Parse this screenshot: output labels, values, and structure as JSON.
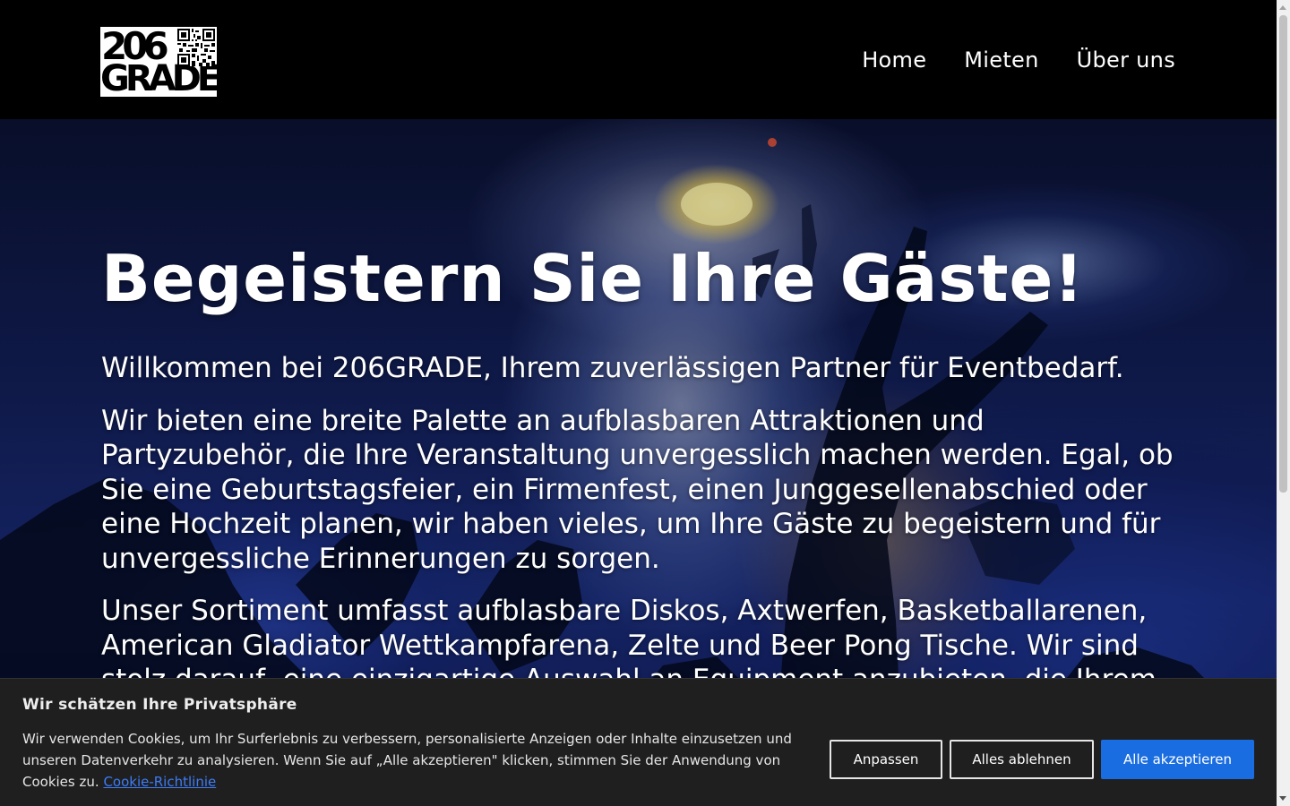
{
  "logo": {
    "line1": "206",
    "line2": "GRADE",
    "qr_icon": "qr-code-icon"
  },
  "nav": {
    "items": [
      "Home",
      "Mieten",
      "Über uns"
    ]
  },
  "hero": {
    "title": "Begeistern Sie Ihre Gäste!",
    "paragraph1": "Willkommen bei 206GRADE, Ihrem zuverlässigen Partner für Eventbedarf.",
    "paragraph2": "Wir bieten eine breite Palette an aufblasbaren Attraktionen und Partyzubehör, die Ihre Veranstaltung unvergesslich machen werden. Egal, ob Sie eine Geburtstagsfeier, ein Firmenfest, einen Junggesellenabschied oder eine Hochzeit planen, wir haben vieles, um Ihre Gäste zu begeistern und für unvergessliche Erinnerungen zu sorgen.",
    "paragraph3": "Unser Sortiment umfasst aufblasbare Diskos, Axtwerfen, Basketballarenen, American Gladiator Wettkampfarena, Zelte und Beer Pong Tische. Wir sind stolz darauf, eine einzigartige Auswahl an Equipment anzubieten, die Ihrem"
  },
  "cookie": {
    "title": "Wir schätzen Ihre Privatsphäre",
    "text": "Wir verwenden Cookies, um Ihr Surferlebnis zu verbessern, personalisierte Anzeigen oder Inhalte einzusetzen und unseren Datenverkehr zu analysieren. Wenn Sie auf „Alle akzeptieren\" klicken, stimmen Sie der Anwendung von Cookies zu.",
    "link": "Cookie-Richtlinie",
    "customize": "Anpassen",
    "reject": "Alles ablehnen",
    "accept": "Alle akzeptieren"
  },
  "colors": {
    "header_bg": "#000000",
    "cookie_bg": "#1f1f1f",
    "accept_btn": "#1a6de0",
    "link": "#3d7cf7"
  }
}
